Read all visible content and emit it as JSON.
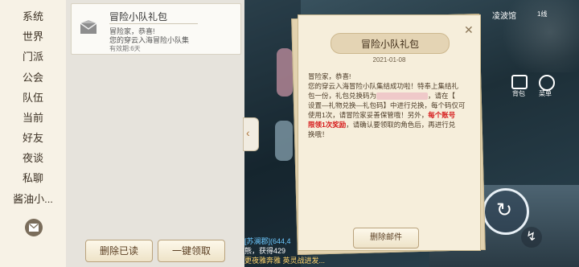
{
  "channels": [
    "系统",
    "世界",
    "门派",
    "公会",
    "队伍",
    "当前",
    "好友",
    "夜谈",
    "私聊",
    "酱油小..."
  ],
  "mail_list": {
    "item": {
      "title": "冒险小队礼包",
      "preview_line1": "冒险家，恭喜!",
      "preview_line2": "您的穿云入海冒险小队集",
      "expiry": "有效期:6天"
    },
    "delete_read_label": "删除已读",
    "claim_all_label": "一键领取"
  },
  "hud": {
    "location": "凌波馆",
    "line": "1线",
    "bag_label": "背包",
    "menu_label": "菜单",
    "chat_log": [
      "[苏澜郡](644,4",
      "熊，获得429",
      "更夜雅奔雅 英灵战进发..."
    ]
  },
  "letter": {
    "title": "冒险小队礼包",
    "date": "2021-01-08",
    "lines": [
      "冒险家，恭喜!",
      "您的穿云入海冒险小队集结成功啦！特奉上集结礼",
      "包一份，礼包兑换码为",
      "，请在【",
      "设置—礼物兑换—礼包码】中进行兑换，每个码仅可",
      "使用1次，请冒险家妥善保管哦！另外，",
      "每个账号",
      "限领1次奖励",
      "，请确认要领取的角色后，再进行兑",
      "换哦！"
    ],
    "delete_label": "删除邮件"
  }
}
